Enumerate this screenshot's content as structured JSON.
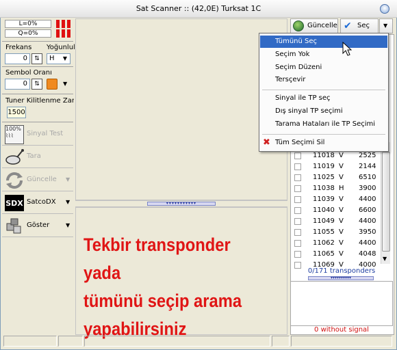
{
  "window": {
    "title": "Sat Scanner :: (42,0E) Turksat 1C"
  },
  "signal": {
    "level": "L=0%",
    "quality": "Q=0%"
  },
  "frequency": {
    "label": "Frekans",
    "value": "0"
  },
  "polarity": {
    "label": "Yoğunlul",
    "value": "H"
  },
  "symbol_rate": {
    "label": "Sembol Oranı",
    "value": "0"
  },
  "tuner_lock": {
    "label": "Tuner Kilitlenme Zamanı",
    "value": "1500"
  },
  "side_buttons": [
    {
      "label": "Sinyal Test",
      "icon": "signal-test-icon"
    },
    {
      "label": "Tara",
      "icon": "scan-dish-icon"
    },
    {
      "label": "Güncelle",
      "icon": "refresh-icon"
    },
    {
      "label": "SatcoDX",
      "icon": "satcodx-icon",
      "icon_text": "SDX"
    },
    {
      "label": "Göster",
      "icon": "show-boxes-icon"
    }
  ],
  "toolbar": {
    "update_label": "Güncelle",
    "select_label": "Seç"
  },
  "menu": {
    "items": [
      {
        "label": "Tümünü Seç"
      },
      {
        "label": "Seçim Yok"
      },
      {
        "label": "Seçim Düzeni"
      },
      {
        "label": "Tersçevir"
      },
      {
        "label": "Sinyal ile TP seç"
      },
      {
        "label": "Dış sinyal TP seçimi"
      },
      {
        "label": "Tarama Hataları ile TP Seçimi"
      },
      {
        "label": "Tüm Seçimi Sil"
      }
    ]
  },
  "transponders": [
    {
      "freq": "11018",
      "pol": "V",
      "rate": "2525"
    },
    {
      "freq": "11019",
      "pol": "V",
      "rate": "2144"
    },
    {
      "freq": "11025",
      "pol": "V",
      "rate": "6510"
    },
    {
      "freq": "11038",
      "pol": "H",
      "rate": "3900"
    },
    {
      "freq": "11039",
      "pol": "V",
      "rate": "4400"
    },
    {
      "freq": "11040",
      "pol": "V",
      "rate": "6600"
    },
    {
      "freq": "11049",
      "pol": "V",
      "rate": "4400"
    },
    {
      "freq": "11055",
      "pol": "V",
      "rate": "3950"
    },
    {
      "freq": "11062",
      "pol": "V",
      "rate": "4400"
    },
    {
      "freq": "11065",
      "pol": "V",
      "rate": "4048"
    },
    {
      "freq": "11069",
      "pol": "V",
      "rate": "4000"
    }
  ],
  "tp_count": "0/171 transponders",
  "no_signal": "0 without signal",
  "overlay": {
    "lines": [
      "Tekbir transponder yada",
      "tümünü seçip arama",
      "yapabilirsiniz"
    ],
    "color": "#e01515"
  },
  "colors": {
    "highlight": "#316ac5",
    "signal_bar": "#e01010"
  }
}
